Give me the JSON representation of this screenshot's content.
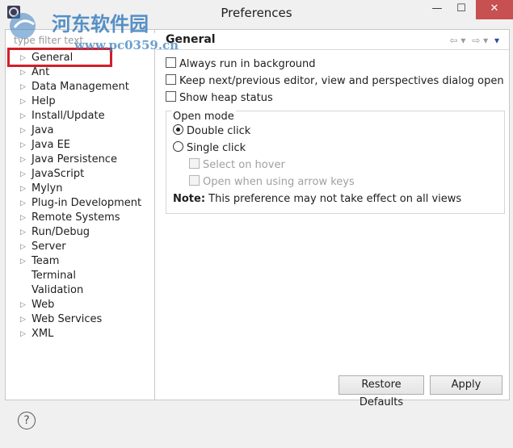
{
  "window": {
    "title": "Preferences",
    "minimize": "—",
    "maximize": "☐",
    "close": "✕"
  },
  "watermark": {
    "text": "河东软件园",
    "url": "www.pc0359.cn"
  },
  "filter": {
    "placeholder": "type filter text"
  },
  "tree": {
    "items": [
      {
        "label": "General",
        "expandable": true
      },
      {
        "label": "Ant",
        "expandable": true
      },
      {
        "label": "Data Management",
        "expandable": true
      },
      {
        "label": "Help",
        "expandable": true
      },
      {
        "label": "Install/Update",
        "expandable": true
      },
      {
        "label": "Java",
        "expandable": true
      },
      {
        "label": "Java EE",
        "expandable": true
      },
      {
        "label": "Java Persistence",
        "expandable": true
      },
      {
        "label": "JavaScript",
        "expandable": true
      },
      {
        "label": "Mylyn",
        "expandable": true
      },
      {
        "label": "Plug-in Development",
        "expandable": true
      },
      {
        "label": "Remote Systems",
        "expandable": true
      },
      {
        "label": "Run/Debug",
        "expandable": true
      },
      {
        "label": "Server",
        "expandable": true
      },
      {
        "label": "Team",
        "expandable": true
      },
      {
        "label": "Terminal",
        "expandable": false
      },
      {
        "label": "Validation",
        "expandable": false
      },
      {
        "label": "Web",
        "expandable": true
      },
      {
        "label": "Web Services",
        "expandable": true
      },
      {
        "label": "XML",
        "expandable": true
      }
    ]
  },
  "page": {
    "title": "General",
    "options": {
      "run_background": "Always run in background",
      "keep_editor": "Keep next/previous editor, view and perspectives dialog open",
      "heap_status": "Show heap status"
    },
    "open_mode": {
      "title": "Open mode",
      "double_click": "Double click",
      "single_click": "Single click",
      "select_hover": "Select on hover",
      "open_arrow": "Open when using arrow keys",
      "note_label": "Note:",
      "note_text": " This preference may not take effect on all views"
    },
    "restore_defaults": "Restore Defaults",
    "apply": "Apply"
  },
  "colors": {
    "highlight_box": "#d01f2a",
    "watermark": "#3a7fbf"
  },
  "icons": [
    "app-icon",
    "back-arrow-icon",
    "forward-arrow-icon",
    "view-menu-icon",
    "help-icon"
  ]
}
